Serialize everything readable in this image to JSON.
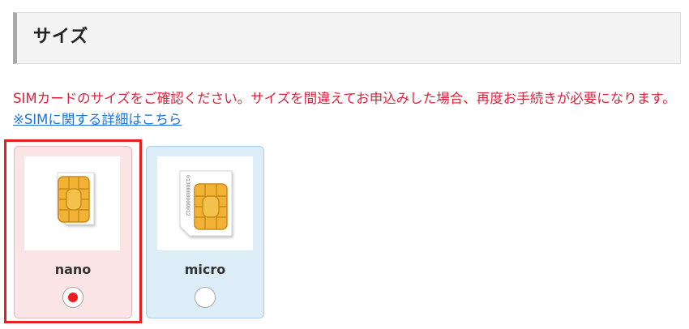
{
  "section": {
    "title": "サイズ"
  },
  "notice": {
    "text": "SIMカードのサイズをご確認ください。サイズを間違えてお申込みした場合、再度お手続きが必要になります。",
    "link": "※SIMに関する詳細はこちら"
  },
  "options": [
    {
      "label": "nano",
      "selected": true,
      "icon": "nano-sim-card-icon"
    },
    {
      "label": "micro",
      "selected": false,
      "icon": "micro-sim-card-icon",
      "card_text": "0130000000012"
    }
  ],
  "colors": {
    "notice_red": "#e0213c",
    "link_blue": "#1d74d9",
    "selected_card_bg": "#fbe4e6",
    "unselected_card_bg": "#ddedf8",
    "selection_border": "#e62020",
    "sim_chip_gold": "#f2b236"
  }
}
